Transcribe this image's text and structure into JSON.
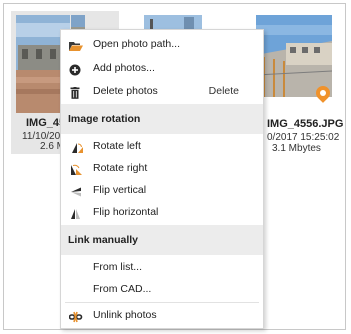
{
  "photos": [
    {
      "name": "IMG_45",
      "date": "11/10/201",
      "size": "2.6 M"
    },
    {
      "name": "IMG_4556.JPG",
      "date": "0/2017 15:25:02",
      "size": "3.1 Mbytes"
    }
  ],
  "menu": {
    "open_photo_path": "Open photo path...",
    "add_photos": "Add photos...",
    "delete_photos": "Delete photos",
    "delete_shortcut": "Delete",
    "image_rotation": "Image rotation",
    "rotate_left": "Rotate left",
    "rotate_right": "Rotate right",
    "flip_vertical": "Flip vertical",
    "flip_horizontal": "Flip horizontal",
    "link_manually": "Link manually",
    "from_list": "From list...",
    "from_cad": "From CAD...",
    "unlink_photos": "Unlink photos"
  },
  "colors": {
    "selection": "#e6e6e6",
    "header_bg": "#ececec",
    "icon_orange": "#e8922e",
    "pin": "#f0922b"
  }
}
